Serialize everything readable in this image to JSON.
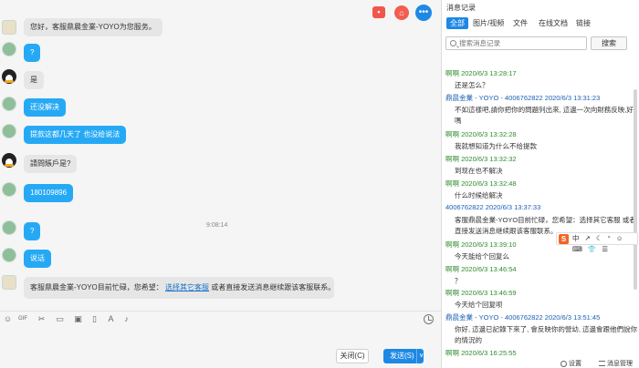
{
  "chat": {
    "messages": [
      {
        "avatar": "staff-avatar",
        "bubble": "gray",
        "text": "您好，客服鼎晨金業-YOYO为您服务。"
      },
      {
        "avatar": "user-avatar",
        "bubble": "blue",
        "text": "?"
      },
      {
        "avatar": "penguin-avatar",
        "bubble": "gray",
        "text": "是"
      },
      {
        "avatar": "user-avatar",
        "bubble": "blue",
        "text": "还没解决"
      },
      {
        "avatar": "user-avatar",
        "bubble": "blue",
        "text": "提款这都几天了 也没给说法"
      },
      {
        "avatar": "penguin-avatar",
        "bubble": "gray",
        "text": "請問賬戶是?"
      },
      {
        "avatar": "user-avatar",
        "bubble": "blue",
        "text": "180109896"
      },
      {
        "avatar": "user-avatar",
        "bubble": "blue",
        "text": "?"
      },
      {
        "avatar": "user-avatar",
        "bubble": "blue",
        "text": "说话"
      },
      {
        "avatar": "staff-avatar",
        "bubble": "gray",
        "text_before": "客服鼎晨金業-YOYO目前忙碌，您希望：",
        "link": "选择其它客服",
        "text_after": "或者直接发送消息继续跟该客服联系。"
      }
    ],
    "timestamp": "9:08:14",
    "close_label": "关闭(C)",
    "send_label": "发送(S)",
    "send_arrow": "∨"
  },
  "history": {
    "title": "消息记录",
    "tabs": [
      "全部",
      "图片/视频",
      "文件",
      "在线文档",
      "链接"
    ],
    "search_placeholder": "搜索消息记录",
    "search_button": "搜索",
    "records": [
      {
        "sender": "啊啊 2020/6/3 13:28:17",
        "color": "green",
        "lines": [
          "还是怎么？"
        ]
      },
      {
        "sender": "鼎晨金業 - YOYO - 4006762822 2020/6/3 13:31:23",
        "color": "blue",
        "lines": [
          "不如這樣吧,請你把你的問題列出來, 這邊一次向財務反映,好",
          "嗎"
        ]
      },
      {
        "sender": "啊啊 2020/6/3 13:32:28",
        "color": "green",
        "lines": [
          "我就想知道为什么不给提款"
        ]
      },
      {
        "sender": "啊啊 2020/6/3 13:32:32",
        "color": "green",
        "lines": [
          "到现在也不解决"
        ]
      },
      {
        "sender": "啊啊 2020/6/3 13:32:48",
        "color": "green",
        "lines": [
          "什么时候给解决"
        ]
      },
      {
        "sender": "4006762822 2020/6/3 13:37:33",
        "color": "blue",
        "lines": [
          "客服鼎晨金業-YOYO目前忙碌，您希望：选择其它客服  或者",
          "直接发送消息继续跟该客服联系。"
        ]
      },
      {
        "sender": "啊啊 2020/6/3 13:39:10",
        "color": "green",
        "lines": [
          "今天能给个回复么"
        ]
      },
      {
        "sender": "啊啊 2020/6/3 13:46:54",
        "color": "green",
        "lines": [
          "？"
        ]
      },
      {
        "sender": "啊啊 2020/6/3 13:46:59",
        "color": "green",
        "lines": [
          "今天给个回复呗"
        ]
      },
      {
        "sender": "鼎晨金業 - YOYO - 4006762822 2020/6/3 13:51:45",
        "color": "blue",
        "lines": [
          "你好, 這邊已記錄下來了, 會反映你的營幼, 這邊會跟他們說你",
          "的情況的"
        ]
      },
      {
        "sender": "啊啊 2020/6/3 16:25:55",
        "color": "green",
        "lines": []
      }
    ],
    "ime_logo": "S",
    "ime_text": "中 ↗ ☾ ° ☺ ⌨ 👕 ☰",
    "settings_label": "设置",
    "manage_label": "消息管理"
  },
  "colors": {
    "accent": "#1e88e5",
    "bubble_blue": "#26a9f5",
    "green_name": "#2e8b2e",
    "blue_name": "#1a5fb4"
  }
}
